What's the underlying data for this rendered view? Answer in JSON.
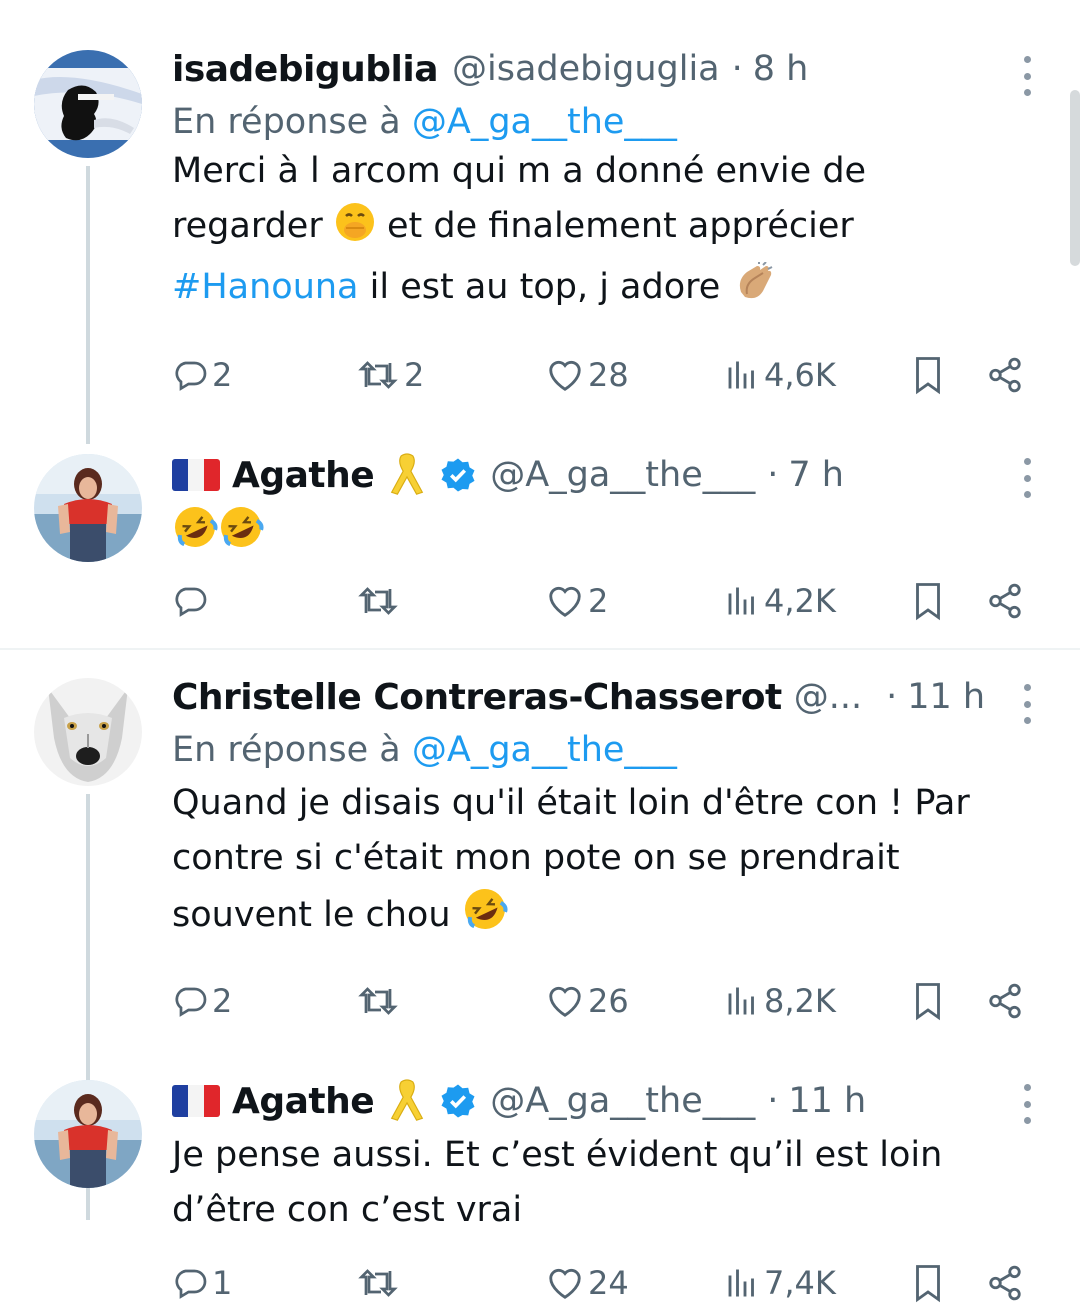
{
  "colors": {
    "link": "#1d9bf0",
    "muted": "#536471",
    "text": "#0f1419"
  },
  "tweets": [
    {
      "name": "isadebigublia",
      "handle": "@isadebiguglia",
      "sep": "·",
      "time": "8 h",
      "reply_prefix": "En réponse à",
      "reply_mention": "@A_ga__the___",
      "body_line1": "Merci à l arcom qui m a donné envie de",
      "body_line2a": "regarder",
      "body_emoji2": "😊🤭",
      "body_line2b": "et de finalement apprécier",
      "hashtag": "#Hanouna",
      "body_line3": "il est au top, j adore",
      "replies": "2",
      "reposts": "2",
      "likes": "28",
      "views": "4,6K"
    },
    {
      "name": "Agathe",
      "handle": "@A_ga__the___",
      "sep": "·",
      "time": "7 h",
      "body": "🤣🤣",
      "replies": "",
      "reposts": "",
      "likes": "2",
      "views": "4,2K"
    },
    {
      "name": "Christelle Contreras-Chasserot",
      "handle": "@...",
      "sep": "·",
      "time": "11 h",
      "reply_prefix": "En réponse à",
      "reply_mention": "@A_ga__the___",
      "body_line1": "Quand je disais qu'il était loin d'être con ! Par",
      "body_line2": "contre si c'était mon pote on se prendrait",
      "body_line3": "souvent le chou",
      "replies": "2",
      "reposts": "",
      "likes": "26",
      "views": "8,2K"
    },
    {
      "name": "Agathe",
      "handle": "@A_ga__the___",
      "sep": "·",
      "time": "11 h",
      "body_line1": "Je pense aussi. Et c’est évident qu’il est loin",
      "body_line2": "d’être con c’est vrai",
      "replies": "1",
      "reposts": "",
      "likes": "24",
      "views": "7,4K"
    }
  ],
  "icons": [
    "reply-icon",
    "repost-icon",
    "like-icon",
    "views-icon",
    "bookmark-icon",
    "share-icon",
    "more-icon",
    "verified-icon",
    "yellow-ribbon-icon",
    "france-flag-icon"
  ]
}
